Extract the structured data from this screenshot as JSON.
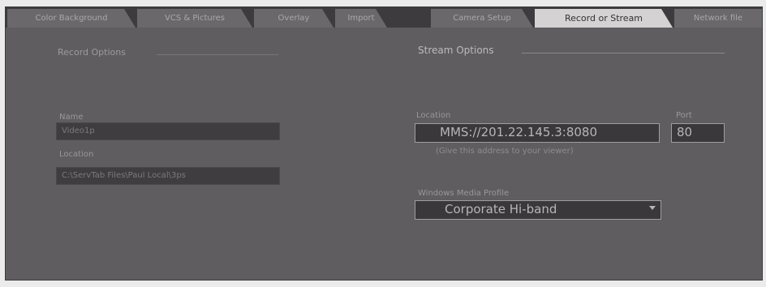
{
  "tabs": [
    {
      "label": "Color Background"
    },
    {
      "label": "VCS & Pictures"
    },
    {
      "label": "Overlay"
    },
    {
      "label": "Import"
    },
    {
      "label": ""
    },
    {
      "label": "Camera Setup"
    },
    {
      "label": "Record or Stream"
    },
    {
      "label": "Network file"
    }
  ],
  "record": {
    "title": "Record Options",
    "name_label": "Name",
    "name_value": "Video1p",
    "location_label": "Location",
    "location_value": "C:\\ServTab Files\\Paul Local\\3ps"
  },
  "stream": {
    "title": "Stream Options",
    "location_label": "Location",
    "location_value": "MMS://201.22.145.3:8080",
    "port_label": "Port",
    "port_value": "80",
    "hint": "(Give this address to your viewer)",
    "profile_label": "Windows Media Profile",
    "profile_value": "Corporate Hi-band"
  }
}
